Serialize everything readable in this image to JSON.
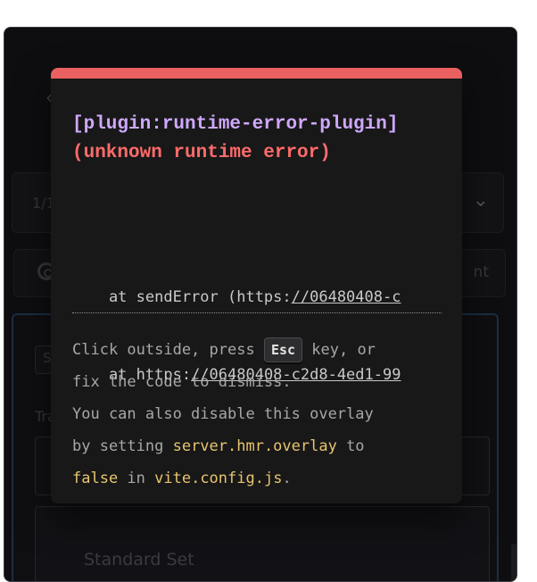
{
  "app": {
    "dropdown_text": "1/1",
    "tab_right_text": "nt",
    "panel_chip_text": "S",
    "field_label": "Tra",
    "select_value": "Standard Set"
  },
  "overlay": {
    "plugin_label": "[plugin:runtime-error-plugin]",
    "error_text": "(unknown runtime error)",
    "stack": [
      {
        "prefix": "    at sendError (https:",
        "url": "//06480408-c"
      },
      {
        "prefix": "    at https:",
        "url": "//06480408-c2d8-4ed1-99"
      }
    ],
    "tip": {
      "line1_a": "Click outside, press ",
      "key": "Esc",
      "line1_b": " key, or",
      "line2": "fix the code to dismiss.",
      "line3": "You can also disable this overlay",
      "line4_a": "by setting ",
      "line4_code": "server.hmr.overlay",
      "line4_b": " to",
      "line5_code1": "false",
      "line5_a": " in ",
      "line5_code2": "vite.config.js",
      "line5_b": "."
    }
  },
  "colors": {
    "accent_bar": "#ea5f5f",
    "plugin": "#cfa8ff",
    "error": "#ff6b6b",
    "code": "#e8c46f"
  }
}
